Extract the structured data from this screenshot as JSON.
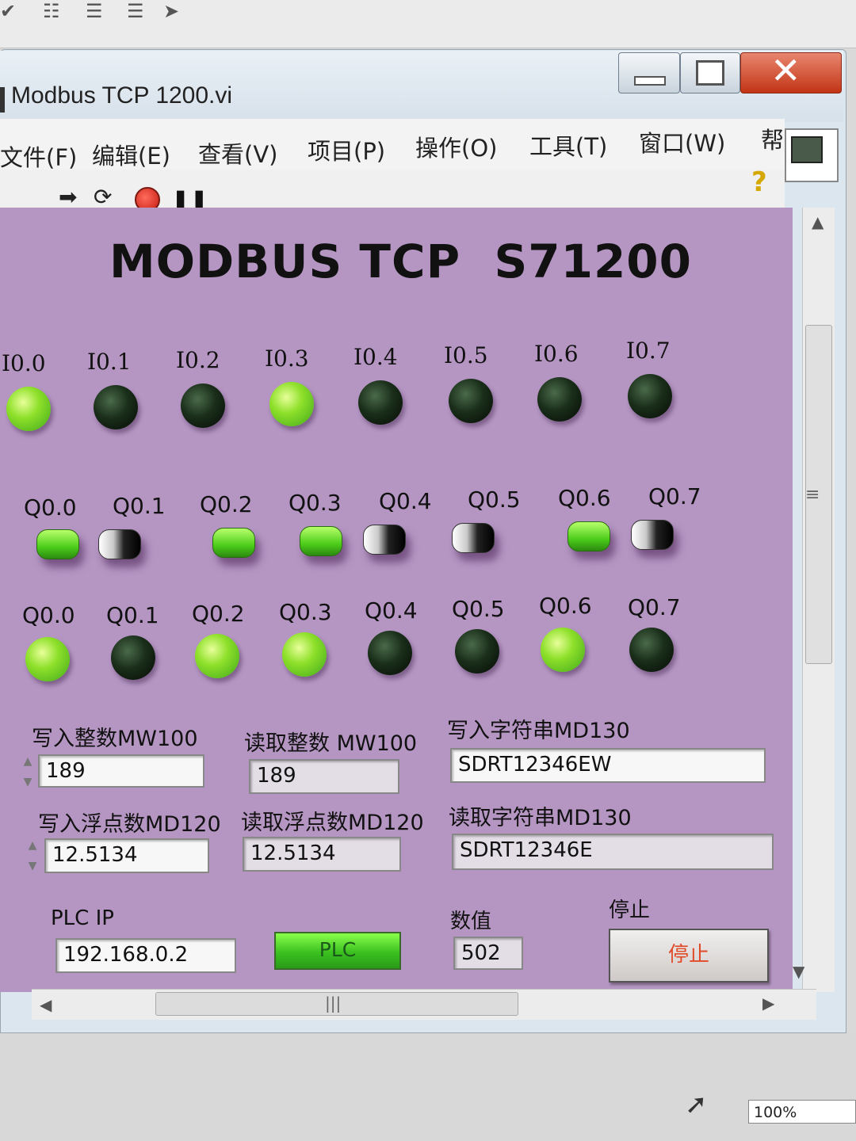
{
  "window": {
    "title": "Modbus TCP 1200.vi"
  },
  "menu": [
    "文件(F)",
    "编辑(E)",
    "查看(V)",
    "项目(P)",
    "操作(O)",
    "工具(T)",
    "窗口(W)",
    "帮"
  ],
  "panel": {
    "title": "MODBUS TCP  S71200"
  },
  "inputs": {
    "labels": [
      "I0.0",
      "I0.1",
      "I0.2",
      "I0.3",
      "I0.4",
      "I0.5",
      "I0.6",
      "I0.7"
    ],
    "states": [
      true,
      false,
      false,
      true,
      false,
      false,
      false,
      false
    ]
  },
  "switches": {
    "labels": [
      "Q0.0",
      "Q0.1",
      "Q0.2",
      "Q0.3",
      "Q0.4",
      "Q0.5",
      "Q0.6",
      "Q0.7"
    ],
    "states": [
      true,
      false,
      true,
      true,
      false,
      false,
      true,
      false
    ]
  },
  "outputs": {
    "labels": [
      "Q0.0",
      "Q0.1",
      "Q0.2",
      "Q0.3",
      "Q0.4",
      "Q0.5",
      "Q0.6",
      "Q0.7"
    ],
    "states": [
      true,
      false,
      true,
      true,
      false,
      false,
      true,
      false
    ]
  },
  "fields": {
    "write_int_label": "写入整数MW100",
    "write_int_value": "189",
    "read_int_label": "读取整数 MW100",
    "read_int_value": "189",
    "write_str_label": "写入字符串MD130",
    "write_str_value": "SDRT12346EW",
    "write_float_label": "写入浮点数MD120",
    "write_float_value": "12.5134",
    "read_float_label": "读取浮点数MD120",
    "read_float_value": "12.5134",
    "read_str_label": "读取字符串MD130",
    "read_str_value": "SDRT12346E",
    "plc_ip_label": "PLC IP",
    "plc_ip_value": "192.168.0.2",
    "plc_button_label": "PLC",
    "numval_label": "数值",
    "numval_value": "502",
    "stop_label": "停止",
    "stop_button_label": "停止"
  },
  "status": {
    "zoom": "100%"
  },
  "colors": {
    "panel_bg": "#b596c3",
    "led_on": "#8ee02a",
    "led_off": "#0a140a",
    "stop_text": "#e14a28"
  }
}
